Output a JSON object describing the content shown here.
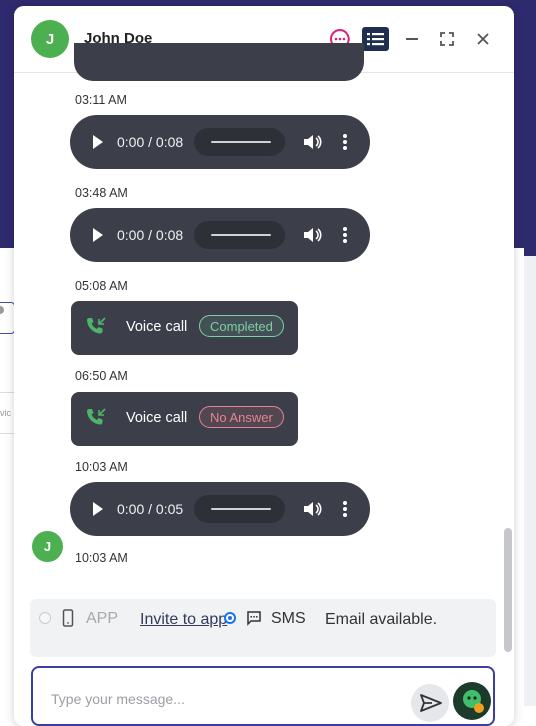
{
  "colors": {
    "accent": "#3b3fa3",
    "avatar_green": "#4caf50",
    "bubble_dark": "#3c3f4a",
    "completed": "#7ed0a3",
    "no_answer": "#e8848f",
    "chat_icon_pink": "#e0207a",
    "list_icon_navy": "#1f2f4f",
    "radio_blue": "#1a73e8"
  },
  "header": {
    "avatar_initial": "J",
    "contact_name": "John Doe",
    "icons": [
      "chat-bubble-icon",
      "list-view-icon",
      "minimize-icon",
      "expand-icon",
      "close-icon"
    ]
  },
  "messages": [
    {
      "kind": "audio-partial",
      "timestamp": "03:11 AM"
    },
    {
      "kind": "audio",
      "time": "0:00 / 0:08",
      "timestamp": "03:48 AM"
    },
    {
      "kind": "audio",
      "time": "0:00 / 0:08",
      "timestamp": "05:08 AM"
    },
    {
      "kind": "call",
      "label": "Voice call",
      "status": "Completed",
      "timestamp": "06:50 AM"
    },
    {
      "kind": "call",
      "label": "Voice call",
      "status": "No Answer",
      "timestamp": "10:03 AM"
    },
    {
      "kind": "audio",
      "time": "0:00 / 0:05",
      "timestamp": "10:03 AM",
      "sender_initial": "J"
    }
  ],
  "channels": {
    "app_label": "APP",
    "invite_link": "Invite to app",
    "sms_label": "SMS",
    "email_note": "Email available.",
    "selected": "SMS"
  },
  "composer": {
    "placeholder": "Type your message..."
  }
}
